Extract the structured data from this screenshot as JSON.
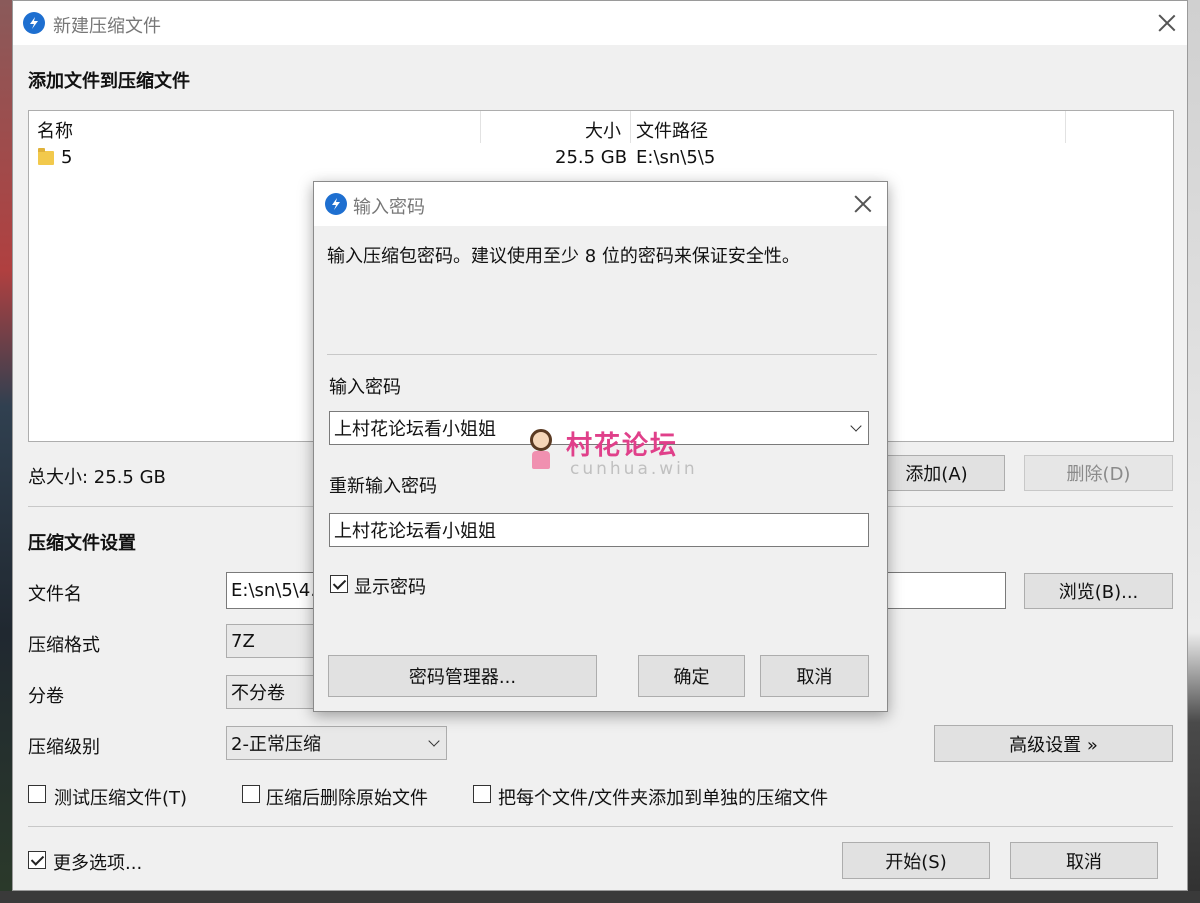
{
  "main_window": {
    "title": "新建压缩文件",
    "add_files_section_title": "添加文件到压缩文件",
    "file_list": {
      "columns": [
        "名称",
        "大小",
        "文件路径"
      ],
      "rows": [
        {
          "name": "5",
          "size": "25.5 GB",
          "path": "E:\\sn\\5\\5"
        }
      ]
    },
    "total_size_label": "总大小: 25.5 GB",
    "add_button": "添加(A)",
    "delete_button": "删除(D)",
    "settings_section_title": "压缩文件设置",
    "filename_label": "文件名",
    "filename_value": "E:\\sn\\5\\4.",
    "browse_button": "浏览(B)...",
    "format_label": "压缩格式",
    "format_value": "7Z",
    "split_label": "分卷",
    "split_value": "不分卷",
    "level_label": "压缩级别",
    "level_value": "2-正常压缩",
    "advanced_button": "高级设置 »",
    "test_checkbox": {
      "label": "测试压缩文件(T)",
      "checked": false
    },
    "delete_after_checkbox": {
      "label": "压缩后删除原始文件",
      "checked": false
    },
    "separate_checkbox": {
      "label": "把每个文件/文件夹添加到单独的压缩文件",
      "checked": false
    },
    "more_options_checkbox": {
      "label": "更多选项...",
      "checked": true
    },
    "start_button": "开始(S)",
    "cancel_button": "取消"
  },
  "password_dialog": {
    "title": "输入密码",
    "instruction": "输入压缩包密码。建议使用至少 8 位的密码来保证安全性。",
    "password_label": "输入密码",
    "password_value": "上村花论坛看小姐姐",
    "confirm_label": "重新输入密码",
    "confirm_value": "上村花论坛看小姐姐",
    "show_password": {
      "label": "显示密码",
      "checked": true
    },
    "manager_button": "密码管理器...",
    "ok_button": "确定",
    "cancel_button": "取消"
  },
  "watermark": {
    "text": "村花论坛",
    "sub": "cunhua.win"
  },
  "colors": {
    "accent": "#1e6fd0",
    "window_bg": "#f0f0f0",
    "watermark": "#e0408a"
  }
}
